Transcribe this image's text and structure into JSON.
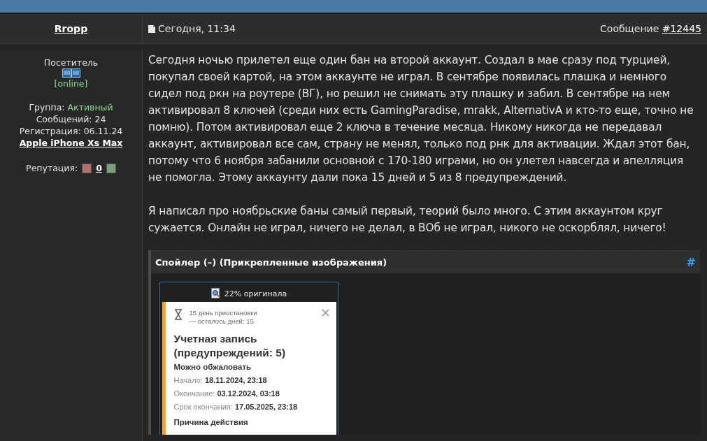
{
  "author": {
    "name": "Rropp",
    "rank": "Посетитель",
    "status": "[online]",
    "group_label": "Группа:",
    "group": "Активный",
    "posts": "Сообщений: 24",
    "registered": "Регистрация: 06.11.24",
    "device": "Apple iPhone Xs Max",
    "reputation_label": "Репутация:",
    "reputation": "0"
  },
  "post": {
    "date": "Сегодня, 11:34",
    "message_label": "Сообщение",
    "message_link": "#12445",
    "paragraphs": [
      "Сегодня ночью прилетел еще один бан на второй аккаунт. Создал в мае сразу под турцией, покупал своей картой, на этом аккаунте не играл. В сентябре появилась плашка и немного сидел под ркн на роутере (ВГ), но решил не снимать эту плашку и забил. В сентябре на нем активировал 8 ключей (среди них есть GamingParadise, mrakk, AlternativA и кто-то еще, точно не помню). Потом активировал еще 2 ключа в течение месяца. Никому никогда не передавал аккаунт, активировал все сам, страну не менял, только под рнк для активации. Ждал этот бан, потому что 6 ноября забанили основной с 170-180 играми, но он улетел навсегда и апелляция не помогла. Этому аккаунту дали пока 15 дней и 5 из 8 предупреждений.",
      "Я написал про ноябрьские баны самый первый, теорий было много. С этим аккаунтом круг сужается. Онлайн не играл, ничего не делал, в ВОб не играл, никого не оскорблял, ничего!"
    ],
    "spoiler": {
      "title": "Спойлер (–) (Прикрепленные изображения)",
      "anchor": "#",
      "attachment": {
        "zoom_label": "22% оригинала",
        "notice": {
          "days": "15 день приостановки",
          "remaining": "— осталось дней: 15",
          "title": "Учетная запись (предупреждений: 5)",
          "appeal": "Можно обжаловать",
          "rows": [
            {
              "label": "Начало:",
              "value": "18.11.2024, 23:18"
            },
            {
              "label": "Окончание:",
              "value": "03.12.2024, 03:18"
            },
            {
              "label": "Срок окончания:",
              "value": "17.05.2025, 23:18"
            }
          ],
          "reason": "Причина действия"
        }
      }
    }
  }
}
